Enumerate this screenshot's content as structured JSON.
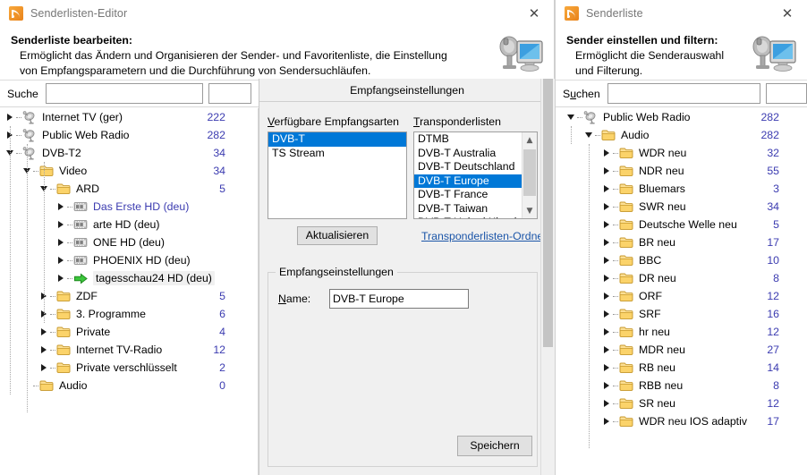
{
  "editor_window": {
    "title": "Senderlisten-Editor",
    "title_icon": "rss-orange-icon",
    "close_label": "✕",
    "banner": {
      "heading": "Senderliste bearbeiten:",
      "body": "Ermöglicht das Ändern und Organisieren der Sender- und Favoritenliste, die Einstellung von Empfangsparametern und die Durchführung von Sendersuchläufen.",
      "icon": "satellite-dish-monitor-icon"
    },
    "search": {
      "label": "Suche",
      "value": "",
      "placeholder": "",
      "secondary_value": ""
    },
    "tree": [
      {
        "label": "Internet TV (ger)",
        "count": "222",
        "depth": 0,
        "icon": "satellite-dish-icon",
        "state": "closed",
        "style": "normal"
      },
      {
        "label": "Public Web Radio",
        "count": "282",
        "depth": 0,
        "icon": "satellite-dish-icon",
        "state": "closed",
        "style": "normal"
      },
      {
        "label": "DVB-T2",
        "count": "34",
        "depth": 0,
        "icon": "satellite-dish-icon",
        "state": "open",
        "style": "normal"
      },
      {
        "label": "Video",
        "count": "34",
        "depth": 1,
        "icon": "folder-icon",
        "state": "open",
        "style": "normal"
      },
      {
        "label": "ARD",
        "count": "5",
        "depth": 2,
        "icon": "folder-icon",
        "state": "open",
        "style": "normal"
      },
      {
        "label": "Das Erste HD (deu)",
        "count": "",
        "depth": 3,
        "icon": "film-icon",
        "state": "closed",
        "style": "link-blue"
      },
      {
        "label": "arte HD (deu)",
        "count": "",
        "depth": 3,
        "icon": "film-icon",
        "state": "closed",
        "style": "normal"
      },
      {
        "label": "ONE HD (deu)",
        "count": "",
        "depth": 3,
        "icon": "film-icon",
        "state": "closed",
        "style": "normal"
      },
      {
        "label": "PHOENIX HD (deu)",
        "count": "",
        "depth": 3,
        "icon": "film-icon",
        "state": "closed",
        "style": "normal"
      },
      {
        "label": "tagesschau24 HD (deu)",
        "count": "",
        "depth": 3,
        "icon": "green-arrow-icon",
        "state": "closed",
        "style": "current"
      },
      {
        "label": "ZDF",
        "count": "5",
        "depth": 2,
        "icon": "folder-icon",
        "state": "closed",
        "style": "normal"
      },
      {
        "label": "3. Programme",
        "count": "6",
        "depth": 2,
        "icon": "folder-icon",
        "state": "closed",
        "style": "normal"
      },
      {
        "label": "Private",
        "count": "4",
        "depth": 2,
        "icon": "folder-icon",
        "state": "closed",
        "style": "normal"
      },
      {
        "label": "Internet TV-Radio",
        "count": "12",
        "depth": 2,
        "icon": "folder-icon",
        "state": "closed",
        "style": "normal"
      },
      {
        "label": "Private verschlüsselt",
        "count": "2",
        "depth": 2,
        "icon": "folder-icon",
        "state": "closed",
        "style": "normal"
      },
      {
        "label": "Audio",
        "count": "0",
        "depth": 1,
        "icon": "folder-icon",
        "state": "none",
        "style": "normal"
      }
    ]
  },
  "middle_panel": {
    "header": "Empfangseinstellungen",
    "reception_types": {
      "label": "Verfügbare Empfangsarten",
      "accesskey": "V",
      "items": [
        "DVB-T",
        "TS Stream"
      ],
      "selected": "DVB-T"
    },
    "transponder_lists": {
      "label": "Transponderlisten",
      "accesskey": "T",
      "items": [
        "DTMB",
        "DVB-T Australia",
        "DVB-T Deutschland",
        "DVB-T Europe",
        "DVB-T France",
        "DVB-T Taiwan",
        "DVB-T United Kingdom"
      ],
      "selected": "DVB-T Europe",
      "scroll_up_icon": "chevron-up-icon",
      "scroll_down_icon": "chevron-down-icon"
    },
    "refresh_button": "Aktualisieren",
    "transponder_folder_link": "Transponderlisten-Ordner",
    "settings_group": {
      "legend": "Empfangseinstellungen",
      "name_label": "Name:",
      "name_accesskey": "N",
      "name_value": "DVB-T Europe"
    },
    "save_button": "Speichern"
  },
  "list_window": {
    "title": "Senderliste",
    "title_icon": "rss-orange-icon",
    "close_label": "✕",
    "banner": {
      "heading": "Sender einstellen und filtern:",
      "body": "Ermöglicht die Senderauswahl und Filterung.",
      "icon": "satellite-dish-monitor-icon"
    },
    "search": {
      "label": "Suchen",
      "accesskey": "u",
      "value": "",
      "placeholder": "",
      "secondary_value": ""
    },
    "tree": [
      {
        "label": "Public Web Radio",
        "count": "282",
        "depth": 0,
        "icon": "satellite-dish-icon",
        "state": "open"
      },
      {
        "label": "Audio",
        "count": "282",
        "depth": 1,
        "icon": "folder-icon",
        "state": "open"
      },
      {
        "label": "WDR neu",
        "count": "32",
        "depth": 2,
        "icon": "folder-icon",
        "state": "closed"
      },
      {
        "label": "NDR neu",
        "count": "55",
        "depth": 2,
        "icon": "folder-icon",
        "state": "closed"
      },
      {
        "label": "Bluemars",
        "count": "3",
        "depth": 2,
        "icon": "folder-icon",
        "state": "closed"
      },
      {
        "label": "SWR neu",
        "count": "34",
        "depth": 2,
        "icon": "folder-icon",
        "state": "closed"
      },
      {
        "label": "Deutsche Welle neu",
        "count": "5",
        "depth": 2,
        "icon": "folder-icon",
        "state": "closed"
      },
      {
        "label": "BR neu",
        "count": "17",
        "depth": 2,
        "icon": "folder-icon",
        "state": "closed"
      },
      {
        "label": "BBC",
        "count": "10",
        "depth": 2,
        "icon": "folder-icon",
        "state": "closed"
      },
      {
        "label": "DR neu",
        "count": "8",
        "depth": 2,
        "icon": "folder-icon",
        "state": "closed"
      },
      {
        "label": "ORF",
        "count": "12",
        "depth": 2,
        "icon": "folder-icon",
        "state": "closed"
      },
      {
        "label": "SRF",
        "count": "16",
        "depth": 2,
        "icon": "folder-icon",
        "state": "closed"
      },
      {
        "label": "hr neu",
        "count": "12",
        "depth": 2,
        "icon": "folder-icon",
        "state": "closed"
      },
      {
        "label": "MDR neu",
        "count": "27",
        "depth": 2,
        "icon": "folder-icon",
        "state": "closed"
      },
      {
        "label": "RB neu",
        "count": "14",
        "depth": 2,
        "icon": "folder-icon",
        "state": "closed"
      },
      {
        "label": "RBB neu",
        "count": "8",
        "depth": 2,
        "icon": "folder-icon",
        "state": "closed"
      },
      {
        "label": "SR neu",
        "count": "12",
        "depth": 2,
        "icon": "folder-icon",
        "state": "closed"
      },
      {
        "label": "WDR neu IOS adaptiv",
        "count": "17",
        "depth": 2,
        "icon": "folder-icon",
        "state": "closed"
      }
    ]
  },
  "colors": {
    "selection_blue": "#0078d7",
    "count_text": "#3b3bb0",
    "link": "#1b55a8",
    "title_text": "#767676",
    "panel_bg": "#f0f0f0"
  }
}
